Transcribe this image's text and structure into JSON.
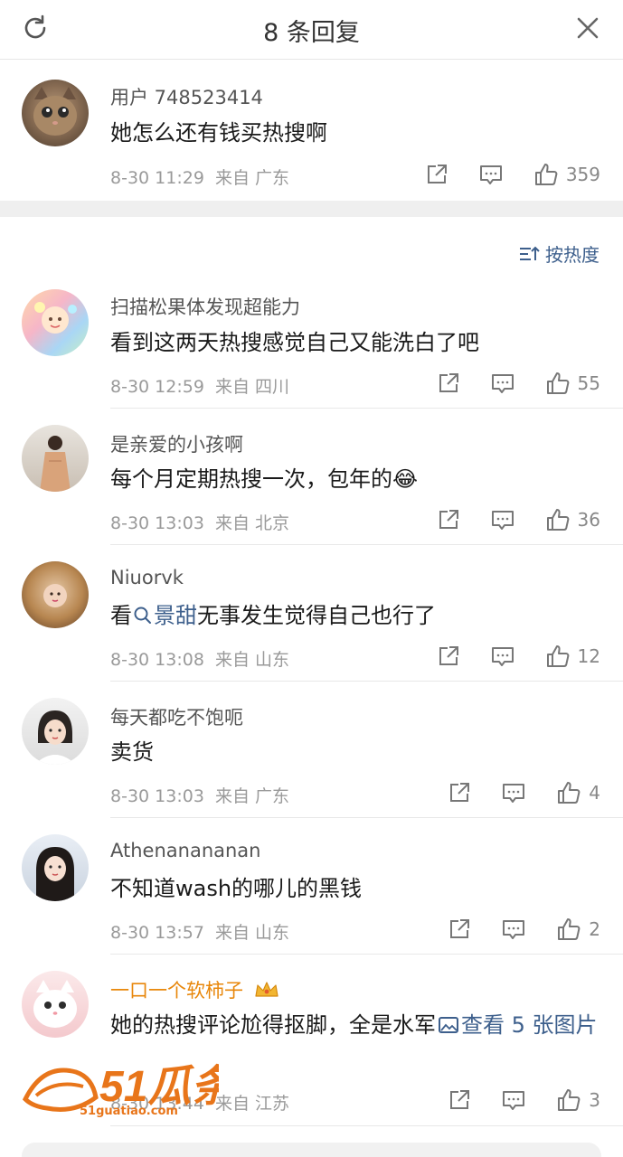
{
  "header": {
    "title": "8 条回复"
  },
  "main_comment": {
    "username": "用户 748523414",
    "text": "她怎么还有钱买热搜啊",
    "time": "8-30 11:29",
    "location": "来自 广东",
    "likes": "359"
  },
  "sort": {
    "label": "按热度"
  },
  "replies": [
    {
      "username": "扫描松果体发现超能力",
      "text": "看到这两天热搜感觉自己又能洗白了吧",
      "time": "8-30 12:59",
      "location": "来自 四川",
      "likes": "55"
    },
    {
      "username": "是亲爱的小孩啊",
      "text": "每个月定期热搜一次，包年的😂",
      "time": "8-30 13:03",
      "location": "来自 北京",
      "likes": "36"
    },
    {
      "username": "Niuorvk",
      "text_before": "看",
      "topic": "景甜",
      "text_after": "无事发生觉得自己也行了",
      "time": "8-30 13:08",
      "location": "来自 山东",
      "likes": "12"
    },
    {
      "username": "每天都吃不饱呃",
      "text": "卖货",
      "time": "8-30 13:03",
      "location": "来自 广东",
      "likes": "4"
    },
    {
      "username": "Athenanananan",
      "text": "不知道wash的哪儿的黑钱",
      "time": "8-30 13:57",
      "location": "来自 山东",
      "likes": "2"
    },
    {
      "username": "一口一个软柿子",
      "text": "她的热搜评论尬得抠脚，全是水军",
      "image_link": "查看 5 张图片",
      "time": "8-30 13:44",
      "location": "来自 江苏",
      "likes": "3"
    }
  ],
  "watermark": {
    "logo": "51瓜条",
    "domain": "51guatiao.com"
  },
  "colors": {
    "link": "#3d5f8c",
    "vip_name": "#e8870b",
    "watermark": "#e8751a"
  }
}
